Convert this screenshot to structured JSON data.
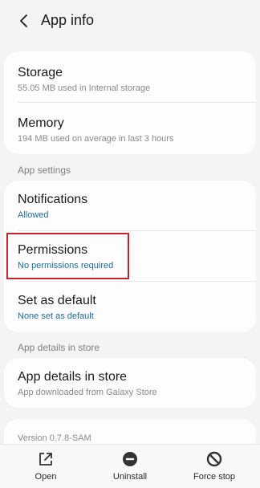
{
  "header": {
    "title": "App info"
  },
  "storage": {
    "title": "Storage",
    "subtitle": "55.05 MB used in Internal storage"
  },
  "memory": {
    "title": "Memory",
    "subtitle": "194 MB used on average in last 3 hours"
  },
  "app_settings": {
    "section_label": "App settings",
    "notifications": {
      "title": "Notifications",
      "subtitle": "Allowed"
    },
    "permissions": {
      "title": "Permissions",
      "subtitle": "No permissions required"
    },
    "set_default": {
      "title": "Set as default",
      "subtitle": "None set as default"
    }
  },
  "store": {
    "section_label": "App details in store",
    "item": {
      "title": "App details in store",
      "subtitle": "App downloaded from Galaxy Store"
    }
  },
  "version": "Version 0.7.8-SAM",
  "bottom_bar": {
    "open": "Open",
    "uninstall": "Uninstall",
    "force_stop": "Force stop"
  },
  "colors": {
    "accent_text": "#1e6a9a",
    "highlight": "#c8232c",
    "background": "#f4f4f4"
  },
  "icons": {
    "back": "chevron-left-icon",
    "open": "open-external-icon",
    "uninstall": "minus-circle-icon",
    "force_stop": "block-icon"
  }
}
